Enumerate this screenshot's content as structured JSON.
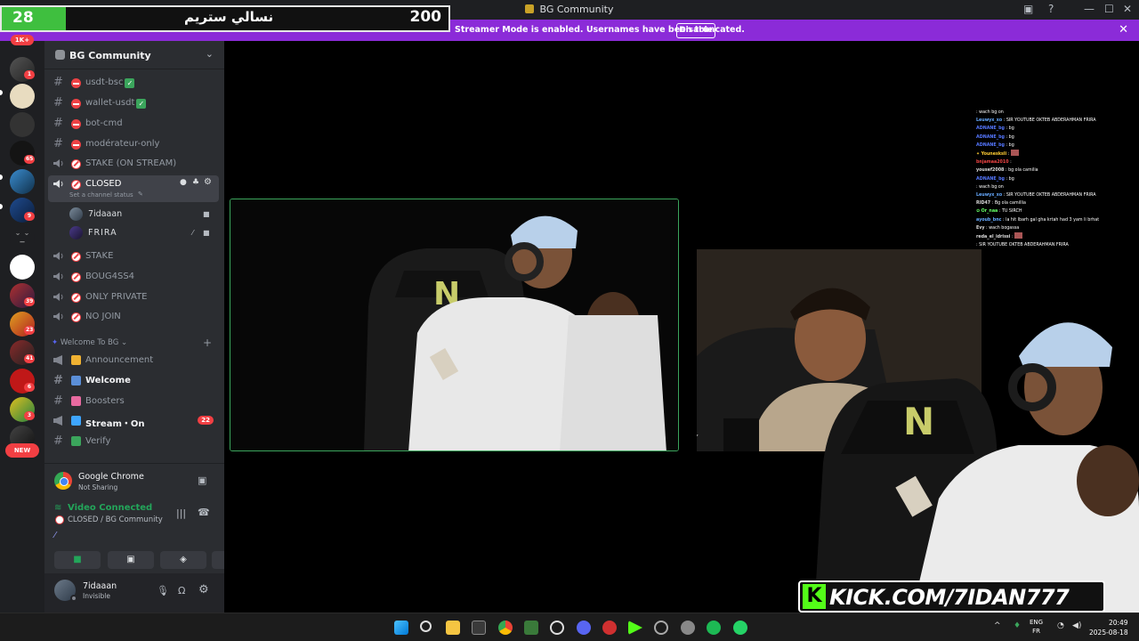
{
  "window": {
    "title": "BG Community"
  },
  "overlay": {
    "left_value": "28",
    "title": "نسالي ستريم",
    "right_value": "200"
  },
  "banner": {
    "text": "Streamer Mode is enabled. Usernames have been truncated.",
    "button": "Disable"
  },
  "rail": {
    "top_badge": "1K+",
    "new_label": "NEW",
    "badges": [
      "1",
      "65",
      "9",
      "39",
      "23",
      "41",
      "6",
      "3"
    ]
  },
  "server": {
    "name": "BG Community"
  },
  "channels": [
    {
      "label": "usdt-bsc"
    },
    {
      "label": "wallet-usdt"
    },
    {
      "label": "bot-cmd"
    },
    {
      "label": "modérateur-only"
    },
    {
      "label": "STAKE (ON STREAM)"
    },
    {
      "label": "CLOSED",
      "status": "Set a channel status"
    },
    {
      "label": "STAKE"
    },
    {
      "label": "BOUG4SS4"
    },
    {
      "label": "ONLY PRIVATE"
    },
    {
      "label": "NO JOIN"
    }
  ],
  "voice_users": [
    {
      "name": "7idaaan"
    },
    {
      "name": "FRIRA"
    }
  ],
  "category": {
    "name": "Welcome To BG"
  },
  "welcome_channels": [
    {
      "label": "Announcement"
    },
    {
      "label": "Welcome"
    },
    {
      "label": "Boosters"
    },
    {
      "label": "Stream・On",
      "badge": "22"
    },
    {
      "label": "Verify"
    }
  ],
  "sharing": {
    "app": "Google Chrome",
    "status": "Not Sharing"
  },
  "voice": {
    "title": "Video Connected",
    "location": "CLOSED / BG Community"
  },
  "user": {
    "name": "7idaaan",
    "status": "Invisible"
  },
  "chat": [
    {
      "user": "",
      "text": ""
    },
    {
      "user": "",
      "text": ""
    },
    {
      "user": "",
      "text": "wach bg on"
    },
    {
      "user": "Leuwyx_xo",
      "text": "SIR YOUTUBE OKTEB ABDERAHMAN FRIRA"
    },
    {
      "user": "ADNANE_bg",
      "text": "bg"
    },
    {
      "user": "ADNANE_bg",
      "text": "bg"
    },
    {
      "user": "ADNANE_bg",
      "text": "bg"
    },
    {
      "user": "Younesksli",
      "text": ""
    },
    {
      "user": "bnjamaa2010",
      "text": ""
    },
    {
      "user": "yousef2008",
      "text": "bg ola camilia"
    },
    {
      "user": "ADNANE_bg",
      "text": "bg"
    },
    {
      "user": "",
      "text": "wach bg on"
    },
    {
      "user": "Leuwyx_xo",
      "text": "SIR YOUTUBE OKTEB ABDERAHMAN FRIRA"
    },
    {
      "user": "RID47",
      "text": "Bg ola camillia"
    },
    {
      "user": "Or_naa",
      "text": "TU SIRCH"
    },
    {
      "user": "ayoub_bnc",
      "text": "la hit lbarh gal gha krtah had 3 yam li brhat"
    },
    {
      "user": "Evy",
      "text": "wach bogassa"
    },
    {
      "user": "",
      "text": ""
    },
    {
      "user": "reda_el_idrissi",
      "text": ""
    },
    {
      "user": "",
      "text": "SIR YOUTUBE OKTEB ABDERAHMAN FRIRA"
    }
  ],
  "kick": {
    "letter": "K",
    "text": "KICK.COM/7IDAN777"
  },
  "taskbar": {
    "lang_top": "ENG",
    "lang_bottom": "FR",
    "time": "20:49",
    "date": "2025-08-18"
  },
  "colors": {
    "accent": "#8b2bd8",
    "online": "#23a55a",
    "danger": "#f23f43",
    "kick": "#53fc18"
  }
}
